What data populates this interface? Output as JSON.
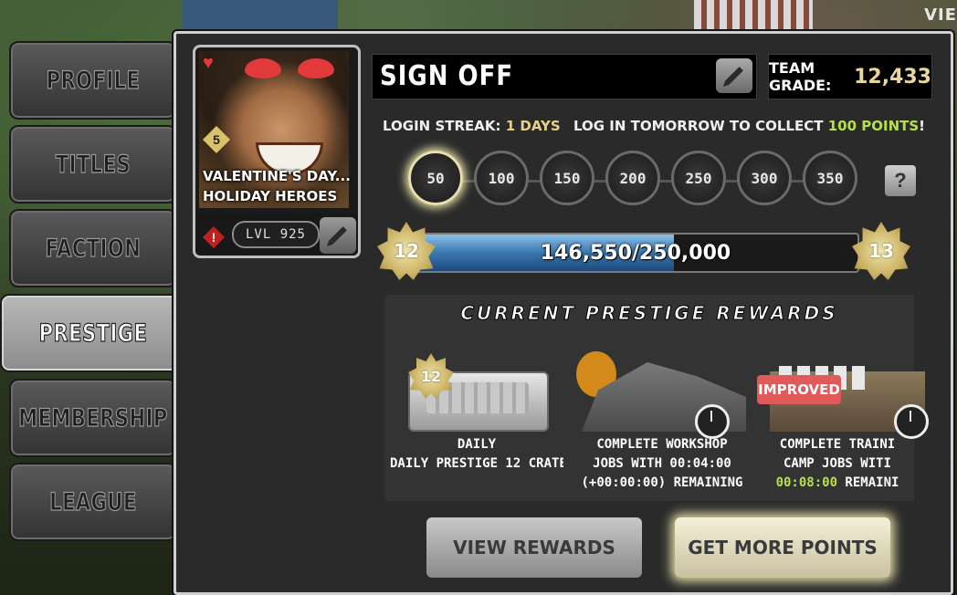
{
  "background": {
    "corner_tab": "VIE"
  },
  "tabs": [
    {
      "label": "PROFILE",
      "active": false
    },
    {
      "label": "TITLES",
      "active": false
    },
    {
      "label": "FACTION",
      "active": false
    },
    {
      "label": "PRESTIGE",
      "active": true
    },
    {
      "label": "MEMBERSHIP",
      "active": false
    },
    {
      "label": "LEAGUE",
      "active": false
    }
  ],
  "card": {
    "line1": "VALENTINE'S DAY...",
    "line2": "HOLIDAY HEROES",
    "stars": "5",
    "level": "LVL 925"
  },
  "profile": {
    "name": "SIGN OFF",
    "team_grade_label": "TEAM GRADE:",
    "team_grade_value": "12,433"
  },
  "streak": {
    "label": "LOGIN STREAK:",
    "value": "1 DAYS",
    "tomorrow_prefix": "LOG IN TOMORROW TO COLLECT",
    "tomorrow_points": "100 POINTS",
    "tomorrow_suffix": "!"
  },
  "milestones": [
    "50",
    "100",
    "150",
    "200",
    "250",
    "300",
    "350"
  ],
  "active_milestone": 0,
  "help_label": "?",
  "progress": {
    "current_level": "12",
    "next_level": "13",
    "text": "146,550/250,000",
    "fraction": 0.5862
  },
  "rewards": {
    "title": "CURRENT PRESTIGE REWARDS",
    "items": [
      {
        "line1": "DAILY",
        "line2": "DAILY PRESTIGE 12 CRATE",
        "badge": "12"
      },
      {
        "line1": "COMPLETE WORKSHOP",
        "line2": "JOBS WITH 00:04:00",
        "line3_extra": "(+00:00:00)",
        "line3_rest": " REMAINING"
      },
      {
        "tag": "IMPROVED",
        "line1": "COMPLETE TRAINI",
        "line2": "CAMP JOBS WITI",
        "line3_green": "00:08:00",
        "line3_rest": " REMAINI"
      }
    ]
  },
  "buttons": {
    "view_rewards": "VIEW REWARDS",
    "get_more_points": "GET MORE POINTS"
  },
  "colors": {
    "accent_gold": "#e9d79a",
    "green": "#b5e04a",
    "bar_blue": "#3a78b0",
    "improved_red": "#e05a5a"
  }
}
